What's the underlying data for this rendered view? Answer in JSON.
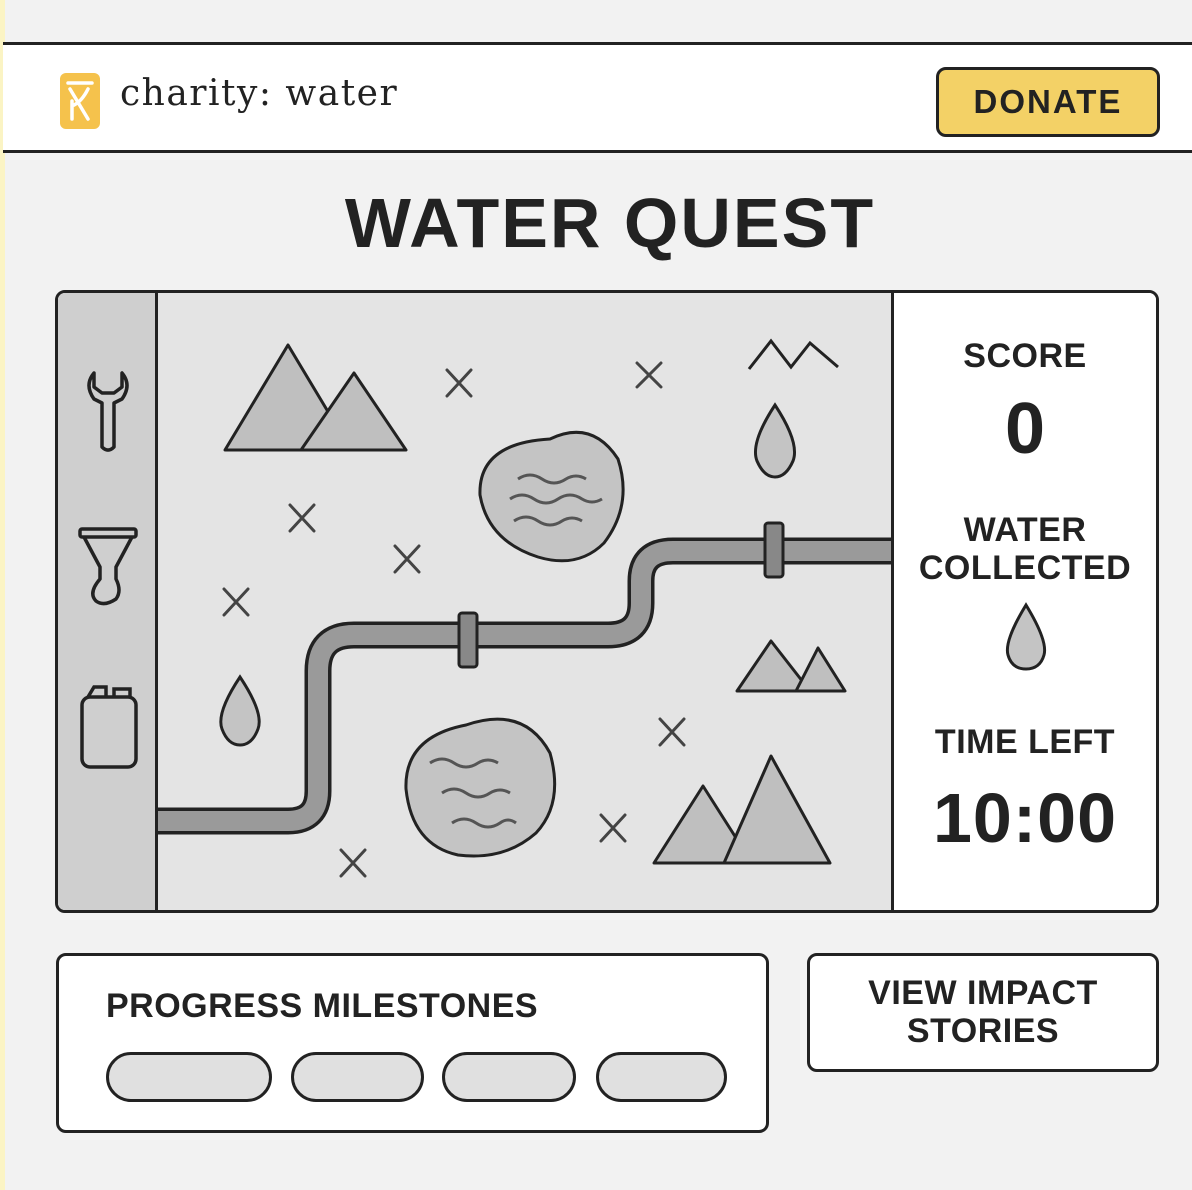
{
  "header": {
    "brand": "charity: water",
    "logo_icon": "jerrycan-logo-icon",
    "donate_label": "DONATE",
    "donate_color": "#f3d166"
  },
  "game": {
    "title": "WATER QUEST",
    "tools": [
      {
        "name": "wrench-icon"
      },
      {
        "name": "filter-funnel-icon"
      },
      {
        "name": "jerrycan-icon"
      }
    ],
    "map_icons": [
      "mountain-icon",
      "x-marker-icon",
      "lake-icon",
      "water-drop-icon",
      "pipe-icon"
    ],
    "stats": {
      "score_label": "SCORE",
      "score_value": "0",
      "water_label_line1": "WATER",
      "water_label_line2": "COLLECTED",
      "water_icon": "water-drop-icon",
      "time_label": "TIME LEFT",
      "time_value": "10:00"
    }
  },
  "milestones": {
    "title": "PROGRESS MILESTONES",
    "count": 4
  },
  "impact": {
    "line1": "VIEW IMPACT",
    "line2": "STORIES"
  }
}
